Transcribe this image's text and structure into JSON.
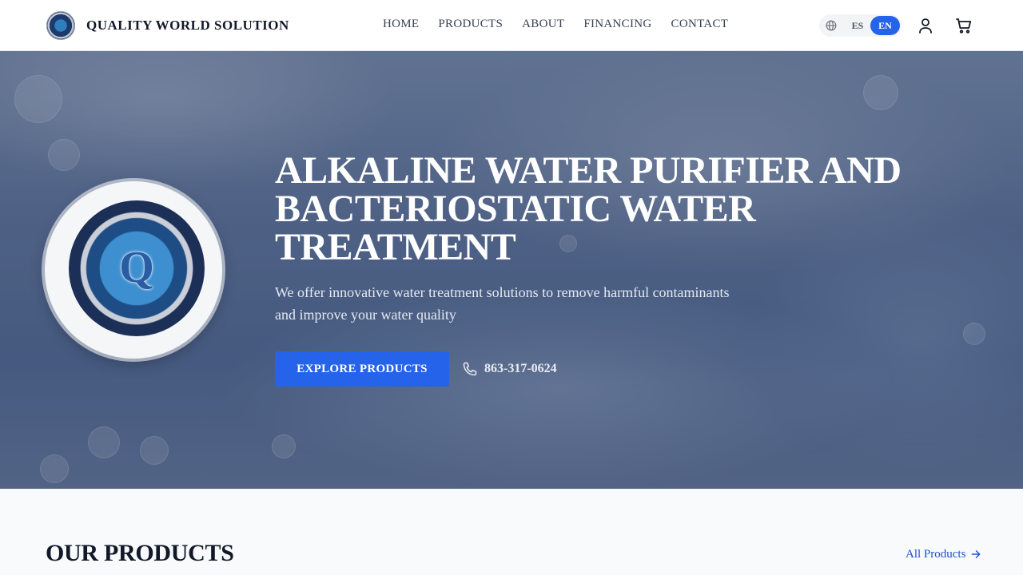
{
  "brand": {
    "name": "QUALITY WORLD SOLUTION",
    "logo_icon": "seal-logo-icon"
  },
  "nav": {
    "items": [
      {
        "label": "HOME"
      },
      {
        "label": "PRODUCTS"
      },
      {
        "label": "ABOUT"
      },
      {
        "label": "FINANCING"
      },
      {
        "label": "CONTACT"
      }
    ]
  },
  "language": {
    "options": [
      "ES",
      "EN"
    ],
    "selected": "EN",
    "icon": "globe-icon"
  },
  "header_icons": {
    "user": "user-icon",
    "cart": "cart-icon"
  },
  "hero": {
    "title": "ALKALINE WATER PURIFIER AND BACTERIOSTATIC WATER TREATMENT",
    "subtitle": "We offer innovative water treatment solutions to remove harmful contaminants and improve your water quality",
    "cta_label": "EXPLORE PRODUCTS",
    "phone": "863-317-0624",
    "phone_icon": "phone-icon",
    "seal_letter": "Q"
  },
  "products_section": {
    "title": "OUR PRODUCTS",
    "link_label": "All Products",
    "link_icon": "arrow-right-icon"
  },
  "colors": {
    "accent": "#2563eb",
    "link": "#1d4ed8",
    "header_bg": "#ffffff",
    "section_bg": "#f8fafc"
  }
}
